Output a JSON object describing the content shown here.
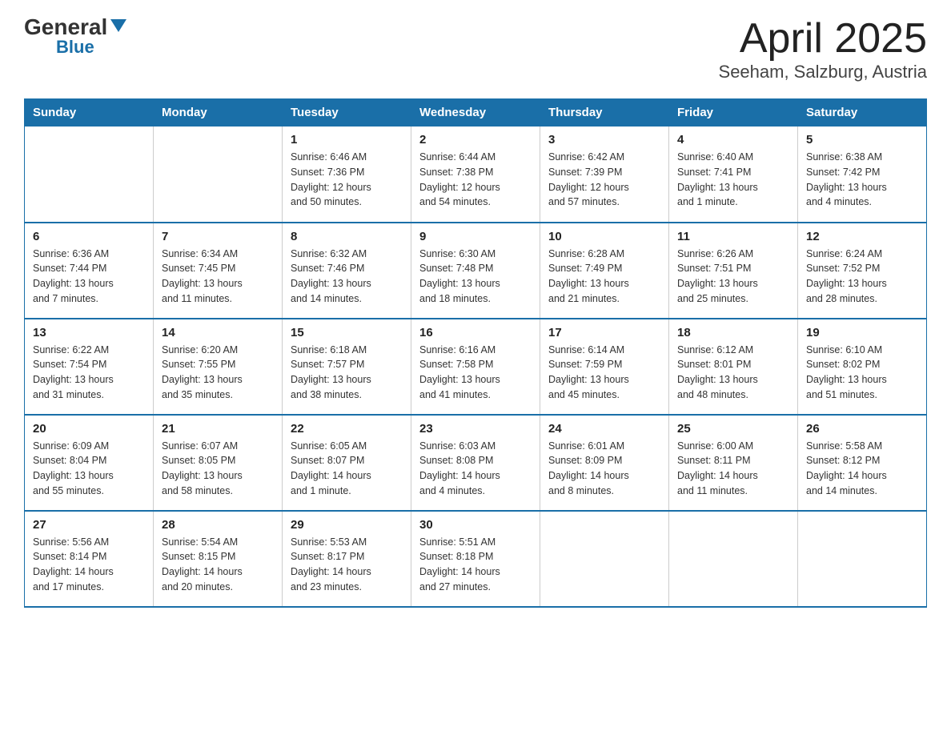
{
  "logo": {
    "general": "General",
    "blue": "Blue"
  },
  "title": "April 2025",
  "subtitle": "Seeham, Salzburg, Austria",
  "days_of_week": [
    "Sunday",
    "Monday",
    "Tuesday",
    "Wednesday",
    "Thursday",
    "Friday",
    "Saturday"
  ],
  "weeks": [
    [
      {
        "day": "",
        "info": ""
      },
      {
        "day": "",
        "info": ""
      },
      {
        "day": "1",
        "info": "Sunrise: 6:46 AM\nSunset: 7:36 PM\nDaylight: 12 hours\nand 50 minutes."
      },
      {
        "day": "2",
        "info": "Sunrise: 6:44 AM\nSunset: 7:38 PM\nDaylight: 12 hours\nand 54 minutes."
      },
      {
        "day": "3",
        "info": "Sunrise: 6:42 AM\nSunset: 7:39 PM\nDaylight: 12 hours\nand 57 minutes."
      },
      {
        "day": "4",
        "info": "Sunrise: 6:40 AM\nSunset: 7:41 PM\nDaylight: 13 hours\nand 1 minute."
      },
      {
        "day": "5",
        "info": "Sunrise: 6:38 AM\nSunset: 7:42 PM\nDaylight: 13 hours\nand 4 minutes."
      }
    ],
    [
      {
        "day": "6",
        "info": "Sunrise: 6:36 AM\nSunset: 7:44 PM\nDaylight: 13 hours\nand 7 minutes."
      },
      {
        "day": "7",
        "info": "Sunrise: 6:34 AM\nSunset: 7:45 PM\nDaylight: 13 hours\nand 11 minutes."
      },
      {
        "day": "8",
        "info": "Sunrise: 6:32 AM\nSunset: 7:46 PM\nDaylight: 13 hours\nand 14 minutes."
      },
      {
        "day": "9",
        "info": "Sunrise: 6:30 AM\nSunset: 7:48 PM\nDaylight: 13 hours\nand 18 minutes."
      },
      {
        "day": "10",
        "info": "Sunrise: 6:28 AM\nSunset: 7:49 PM\nDaylight: 13 hours\nand 21 minutes."
      },
      {
        "day": "11",
        "info": "Sunrise: 6:26 AM\nSunset: 7:51 PM\nDaylight: 13 hours\nand 25 minutes."
      },
      {
        "day": "12",
        "info": "Sunrise: 6:24 AM\nSunset: 7:52 PM\nDaylight: 13 hours\nand 28 minutes."
      }
    ],
    [
      {
        "day": "13",
        "info": "Sunrise: 6:22 AM\nSunset: 7:54 PM\nDaylight: 13 hours\nand 31 minutes."
      },
      {
        "day": "14",
        "info": "Sunrise: 6:20 AM\nSunset: 7:55 PM\nDaylight: 13 hours\nand 35 minutes."
      },
      {
        "day": "15",
        "info": "Sunrise: 6:18 AM\nSunset: 7:57 PM\nDaylight: 13 hours\nand 38 minutes."
      },
      {
        "day": "16",
        "info": "Sunrise: 6:16 AM\nSunset: 7:58 PM\nDaylight: 13 hours\nand 41 minutes."
      },
      {
        "day": "17",
        "info": "Sunrise: 6:14 AM\nSunset: 7:59 PM\nDaylight: 13 hours\nand 45 minutes."
      },
      {
        "day": "18",
        "info": "Sunrise: 6:12 AM\nSunset: 8:01 PM\nDaylight: 13 hours\nand 48 minutes."
      },
      {
        "day": "19",
        "info": "Sunrise: 6:10 AM\nSunset: 8:02 PM\nDaylight: 13 hours\nand 51 minutes."
      }
    ],
    [
      {
        "day": "20",
        "info": "Sunrise: 6:09 AM\nSunset: 8:04 PM\nDaylight: 13 hours\nand 55 minutes."
      },
      {
        "day": "21",
        "info": "Sunrise: 6:07 AM\nSunset: 8:05 PM\nDaylight: 13 hours\nand 58 minutes."
      },
      {
        "day": "22",
        "info": "Sunrise: 6:05 AM\nSunset: 8:07 PM\nDaylight: 14 hours\nand 1 minute."
      },
      {
        "day": "23",
        "info": "Sunrise: 6:03 AM\nSunset: 8:08 PM\nDaylight: 14 hours\nand 4 minutes."
      },
      {
        "day": "24",
        "info": "Sunrise: 6:01 AM\nSunset: 8:09 PM\nDaylight: 14 hours\nand 8 minutes."
      },
      {
        "day": "25",
        "info": "Sunrise: 6:00 AM\nSunset: 8:11 PM\nDaylight: 14 hours\nand 11 minutes."
      },
      {
        "day": "26",
        "info": "Sunrise: 5:58 AM\nSunset: 8:12 PM\nDaylight: 14 hours\nand 14 minutes."
      }
    ],
    [
      {
        "day": "27",
        "info": "Sunrise: 5:56 AM\nSunset: 8:14 PM\nDaylight: 14 hours\nand 17 minutes."
      },
      {
        "day": "28",
        "info": "Sunrise: 5:54 AM\nSunset: 8:15 PM\nDaylight: 14 hours\nand 20 minutes."
      },
      {
        "day": "29",
        "info": "Sunrise: 5:53 AM\nSunset: 8:17 PM\nDaylight: 14 hours\nand 23 minutes."
      },
      {
        "day": "30",
        "info": "Sunrise: 5:51 AM\nSunset: 8:18 PM\nDaylight: 14 hours\nand 27 minutes."
      },
      {
        "day": "",
        "info": ""
      },
      {
        "day": "",
        "info": ""
      },
      {
        "day": "",
        "info": ""
      }
    ]
  ]
}
